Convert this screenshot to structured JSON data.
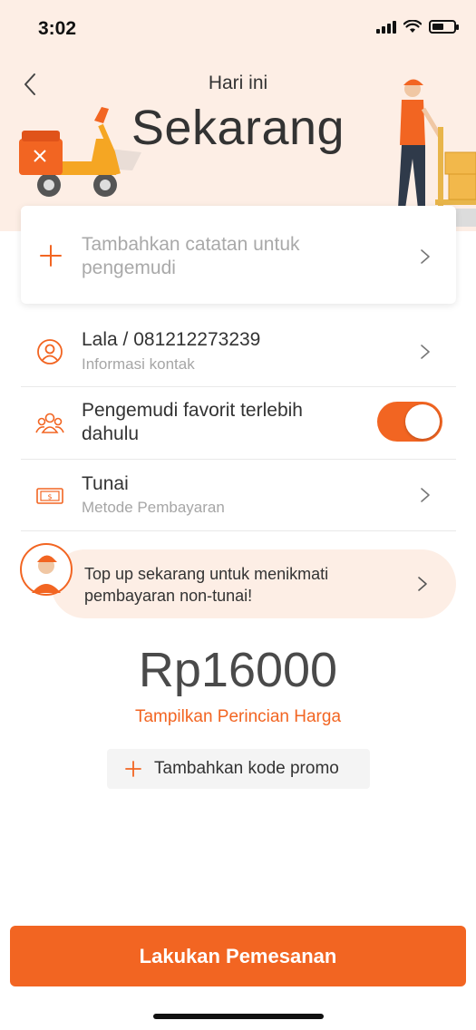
{
  "status_bar": {
    "time": "3:02"
  },
  "header": {
    "subtitle": "Hari ini",
    "title": "Sekarang"
  },
  "note": {
    "placeholder": "Tambahkan catatan untuk pengemudi"
  },
  "contact": {
    "title": "Lala / 081212273239",
    "subtitle": "Informasi kontak"
  },
  "favorite_driver": {
    "title": "Pengemudi favorit terlebih dahulu",
    "enabled": true
  },
  "payment": {
    "title": "Tunai",
    "subtitle": "Metode Pembayaran"
  },
  "topup_banner": {
    "text": "Top up sekarang untuk menikmati pembayaran non-tunai!"
  },
  "price": {
    "amount": "Rp16000",
    "details_link": "Tampilkan Perincian Harga"
  },
  "promo": {
    "label": "Tambahkan kode promo"
  },
  "order_button": {
    "label": "Lakukan Pemesanan"
  },
  "colors": {
    "accent": "#f26522",
    "hero_background": "#fdeee5"
  },
  "icons": [
    "back-chevron-icon",
    "plus-icon",
    "chevron-right-icon",
    "person-icon",
    "group-icon",
    "cash-icon"
  ]
}
